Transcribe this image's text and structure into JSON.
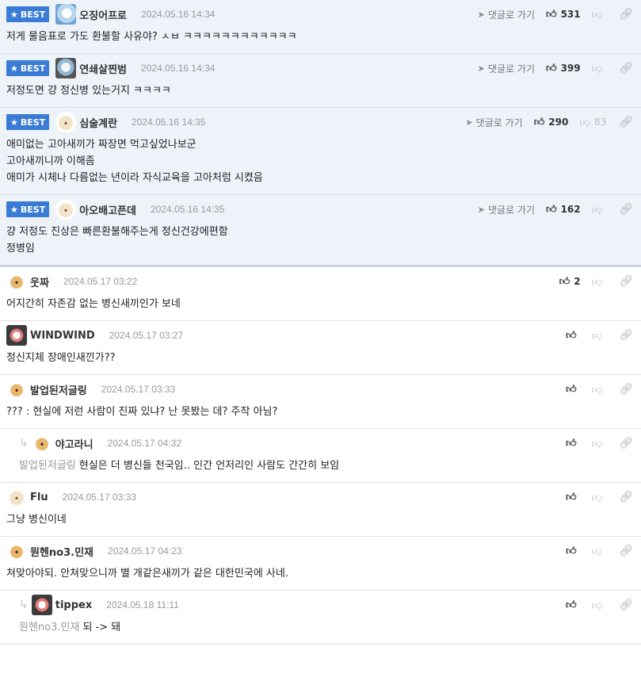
{
  "labels": {
    "best": "BEST",
    "reply_go": "댓글로 가기"
  },
  "comments": [
    {
      "best": true,
      "avatar": "av-blue",
      "nick": "오징어프로",
      "date": "2024.05.16 14:34",
      "likes": "531",
      "dislikes": "",
      "lines": [
        "저게 물음표로 가도 환불할 사유야? ㅅㅂ ㅋㅋㅋㅋㅋㅋㅋㅋㅋㅋㅋㅋ"
      ]
    },
    {
      "best": true,
      "avatar": "av-gray",
      "nick": "연쇄살찐범",
      "date": "2024.05.16 14:34",
      "likes": "399",
      "dislikes": "",
      "lines": [
        "저정도면 걍 정신병 있는거지 ㅋㅋㅋㅋ"
      ]
    },
    {
      "best": true,
      "avatar": "av-dog",
      "nick": "심술계란",
      "date": "2024.05.16 14:35",
      "likes": "290",
      "dislikes": "83",
      "lines": [
        "애미없는 고아새끼가 짜장면 먹고싶었나보군",
        "고아새끼니까 이해좀",
        "애미가 시체나 다름없는 년이라 자식교육을 고아처럼 시켰음"
      ]
    },
    {
      "best": true,
      "avatar": "av-dog",
      "nick": "아오배고픈데",
      "date": "2024.05.16 14:35",
      "likes": "162",
      "dislikes": "",
      "lines": [
        "걍 저정도 진상은 빠른환불해주는게 정신건강에편함",
        "정병임"
      ]
    },
    {
      "best": false,
      "avatar": "av-cat",
      "nick": "웃짜",
      "date": "2024.05.17 03:22",
      "likes": "2",
      "dislikes": "",
      "lines": [
        "어지간히 자존감 없는 병신새끼인가 보네"
      ]
    },
    {
      "best": false,
      "avatar": "av-pink",
      "nick": "WINDWIND",
      "date": "2024.05.17 03:27",
      "likes": "",
      "dislikes": "",
      "lines": [
        "정신지체 장애인새낀가??"
      ]
    },
    {
      "best": false,
      "avatar": "av-cat",
      "nick": "발업된저글링",
      "date": "2024.05.17 03:33",
      "likes": "",
      "dislikes": "",
      "lines": [
        "??? : 현실에 저런 사람이 진짜 있냐? 난 못봤는 데? 주작 아님?"
      ]
    },
    {
      "best": false,
      "reply": true,
      "avatar": "av-cat",
      "nick": "야고라니",
      "date": "2024.05.17 04:32",
      "likes": "",
      "dislikes": "",
      "mention": "발업된저글링",
      "lines": [
        "현실은 더 병신들 천국임.. 인간 언저리인 사람도 간간히 보임"
      ]
    },
    {
      "best": false,
      "avatar": "av-dog",
      "nick": "Flu",
      "date": "2024.05.17 03:33",
      "likes": "",
      "dislikes": "",
      "lines": [
        "그냥 병신이네"
      ]
    },
    {
      "best": false,
      "avatar": "av-cat",
      "nick": "뭔헨no3.민재",
      "date": "2024.05.17 04:23",
      "likes": "",
      "dislikes": "",
      "lines": [
        "쳐맞아야되. 안쳐맞으니까 별 개같은새끼가 같은 대한민국에 사네."
      ]
    },
    {
      "best": false,
      "reply": true,
      "avatar": "av-pink",
      "nick": "tippex",
      "date": "2024.05.18 11:11",
      "likes": "",
      "dislikes": "",
      "mention": "뭔헨no3.민재",
      "lines": [
        "되 -> 돼"
      ]
    }
  ]
}
